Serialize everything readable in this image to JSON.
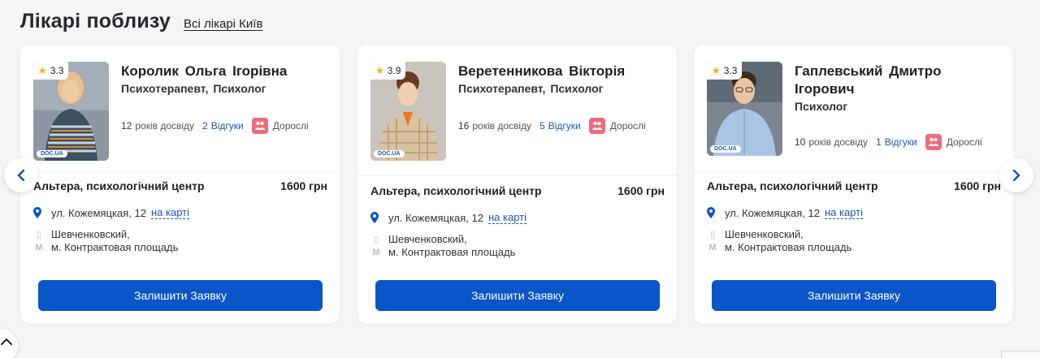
{
  "header": {
    "title": "Лікарі поблизу",
    "all_link": "Всі лікарі Київ"
  },
  "doctors": [
    {
      "rating": "3.3",
      "name": "Королик  Ольга Ігорівна",
      "specialties": "Психотерапевт,  Психолог",
      "experience_years": "12",
      "experience_label": "років досвіду",
      "reviews_count": "2",
      "reviews_label": "Відгуки",
      "age_group": "Дорослі",
      "clinic": "Альтера, психологічний центр",
      "price": "1600 грн",
      "address": "ул. Кожемяцкая, 12",
      "map_link": "на карті",
      "district": "Шевченковский,",
      "metro": "м. Контрактовая площадь",
      "cta": "Залишити Заявку",
      "photo_badge": "DOC.UA"
    },
    {
      "rating": "3.9",
      "name": "Веретенникова  Вікторія",
      "specialties": "Психотерапевт,  Психолог",
      "experience_years": "16",
      "experience_label": "років досвіду",
      "reviews_count": "5",
      "reviews_label": "Відгуки",
      "age_group": "Дорослі",
      "clinic": "Альтера, психологічний центр",
      "price": "1600 грн",
      "address": "ул. Кожемяцкая, 12",
      "map_link": "на карті",
      "district": "Шевченковский,",
      "metro": "м. Контрактовая площадь",
      "cta": "Залишити Заявку",
      "photo_badge": "DOC.UA"
    },
    {
      "rating": "3.3",
      "name": "Гаплевський  Дмитро Ігорович",
      "specialties": "Психолог",
      "experience_years": "10",
      "experience_label": "років досвіду",
      "reviews_count": "1",
      "reviews_label": "Відгуки",
      "age_group": "Дорослі",
      "clinic": "Альтера, психологічний центр",
      "price": "1600 грн",
      "address": "ул. Кожемяцкая, 12",
      "map_link": "на карті",
      "district": "Шевченковский,",
      "metro": "м. Контрактовая площадь",
      "cta": "Залишити Заявку",
      "photo_badge": "DOC.UA"
    }
  ],
  "colors": {
    "accent": "#0a56c8",
    "link": "#1a56c4",
    "star": "#f5b400",
    "adult_badge": "#f06a7a"
  }
}
